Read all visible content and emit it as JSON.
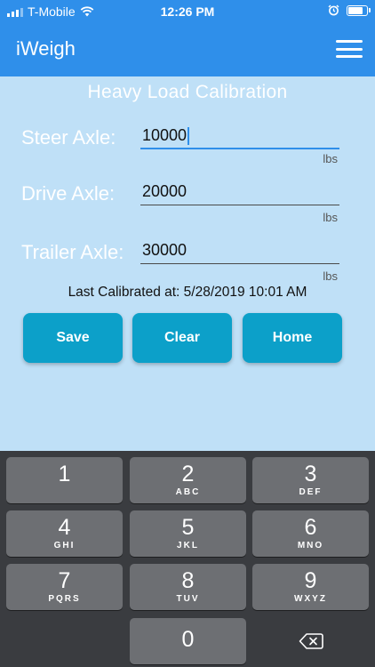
{
  "status_bar": {
    "carrier": "T-Mobile",
    "time": "12:26 PM",
    "battery_level": 0.9
  },
  "nav": {
    "app_title": "iWeigh",
    "menu_icon": "hamburger-menu-icon"
  },
  "page": {
    "title": "Heavy Load Calibration"
  },
  "fields": {
    "steer": {
      "label": "Steer Axle:",
      "value": "10000",
      "unit": "lbs"
    },
    "drive": {
      "label": "Drive Axle:",
      "value": "20000",
      "unit": "lbs"
    },
    "trailer": {
      "label": "Trailer Axle:",
      "value": "30000",
      "unit": "lbs"
    }
  },
  "last_calibrated": "Last Calibrated at: 5/28/2019 10:01 AM",
  "buttons": {
    "save": "Save",
    "clear": "Clear",
    "home": "Home"
  },
  "colors": {
    "header": "#2f8fea",
    "background": "#bfe0f7",
    "button": "#0ca0c9",
    "keyboard": "#3a3c40",
    "key": "#6d6f73"
  },
  "keypad": {
    "k1": {
      "num": "1",
      "letters": ""
    },
    "k2": {
      "num": "2",
      "letters": "ABC"
    },
    "k3": {
      "num": "3",
      "letters": "DEF"
    },
    "k4": {
      "num": "4",
      "letters": "GHI"
    },
    "k5": {
      "num": "5",
      "letters": "JKL"
    },
    "k6": {
      "num": "6",
      "letters": "MNO"
    },
    "k7": {
      "num": "7",
      "letters": "PQRS"
    },
    "k8": {
      "num": "8",
      "letters": "TUV"
    },
    "k9": {
      "num": "9",
      "letters": "WXYZ"
    },
    "k0": {
      "num": "0"
    },
    "backspace_icon": "backspace-icon"
  }
}
